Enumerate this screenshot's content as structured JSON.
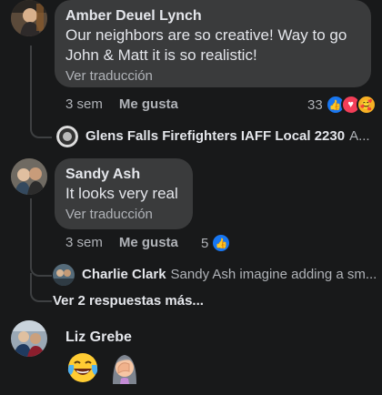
{
  "comments": [
    {
      "author": "Amber Deuel Lynch",
      "text": "Our neighbors are so creative! Way to go John & Matt it is so realistic!",
      "translate": "Ver traducción",
      "time": "3 sem",
      "like": "Me gusta",
      "reaction_count": "33"
    },
    {
      "author": "Sandy Ash",
      "text": "It looks very real",
      "translate": "Ver traducción",
      "time": "3 sem",
      "like": "Me gusta",
      "reaction_count": "5"
    },
    {
      "author": "Liz Grebe",
      "emojis": [
        "face-with-tears-of-joy-icon",
        "woman-facepalming-icon"
      ]
    }
  ],
  "replies": [
    {
      "author": "Glens Falls Firefighters IAFF Local 2230",
      "snippet": "A..."
    },
    {
      "author": "Charlie Clark",
      "snippet": "Sandy Ash imagine adding a sm..."
    }
  ],
  "more_replies": "Ver 2 respuestas más...",
  "colors": {
    "background": "#18191a",
    "bubble": "#3a3b3c",
    "like_blue": "#1877f2",
    "love_red": "#f33e58"
  }
}
